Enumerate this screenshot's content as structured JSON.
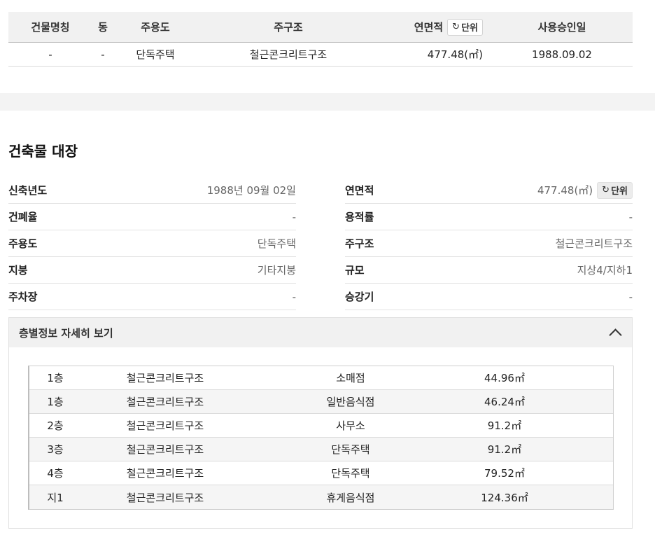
{
  "summary": {
    "headers": [
      "건물명칭",
      "동",
      "주용도",
      "주구조",
      "연면적",
      "사용승인일"
    ],
    "unit_label": "단위",
    "row": {
      "name": "-",
      "dong": "-",
      "use": "단독주택",
      "structure": "철근콘크리트구조",
      "area": "477.48(㎡)",
      "approval": "1988.09.02"
    }
  },
  "ledger": {
    "title": "건축물 대장",
    "left": [
      {
        "label": "신축년도",
        "value": "1988년 09월 02일"
      },
      {
        "label": "건폐율",
        "value": "-"
      },
      {
        "label": "주용도",
        "value": "단독주택"
      },
      {
        "label": "지붕",
        "value": "기타지붕"
      },
      {
        "label": "주차장",
        "value": "-"
      }
    ],
    "right": [
      {
        "label": "연면적",
        "value": "477.48(㎡)"
      },
      {
        "label": "용적률",
        "value": "-"
      },
      {
        "label": "주구조",
        "value": "철근콘크리트구조"
      },
      {
        "label": "규모",
        "value": "지상4/지하1"
      },
      {
        "label": "승강기",
        "value": "-"
      }
    ],
    "unit_label": "단위"
  },
  "floors": {
    "toggle_label": "층별정보 자세히 보기",
    "rows": [
      {
        "floor": "1층",
        "structure": "철근콘크리트구조",
        "use": "소매점",
        "area": "44.96㎡"
      },
      {
        "floor": "1층",
        "structure": "철근콘크리트구조",
        "use": "일반음식점",
        "area": "46.24㎡"
      },
      {
        "floor": "2층",
        "structure": "철근콘크리트구조",
        "use": "사무소",
        "area": "91.2㎡"
      },
      {
        "floor": "3층",
        "structure": "철근콘크리트구조",
        "use": "단독주택",
        "area": "91.2㎡"
      },
      {
        "floor": "4층",
        "structure": "철근콘크리트구조",
        "use": "단독주택",
        "area": "79.52㎡"
      },
      {
        "floor": "지1",
        "structure": "철근콘크리트구조",
        "use": "휴게음식점",
        "area": "124.36㎡"
      }
    ]
  },
  "icons": {
    "refresh": "refresh-icon",
    "collapse": "chevron-up-icon"
  }
}
